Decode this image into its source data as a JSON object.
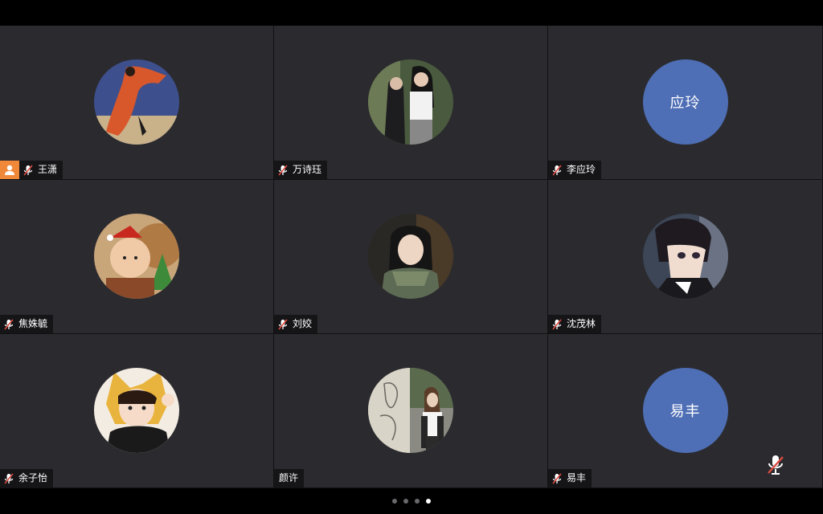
{
  "colors": {
    "tile_bg": "#2b2b2f",
    "avatar_blue": "#4e6eb5",
    "host_badge": "#f0883a",
    "mute_red": "#e04a3f"
  },
  "participants": [
    {
      "name": "王潇",
      "avatar": "photo",
      "muted": true,
      "host": true
    },
    {
      "name": "万诗珏",
      "avatar": "photo",
      "muted": true,
      "host": false
    },
    {
      "name": "李应玲",
      "avatar_text": "应玲",
      "muted": true,
      "host": false
    },
    {
      "name": "焦姝毓",
      "avatar": "photo",
      "muted": true,
      "host": false
    },
    {
      "name": "刘姣",
      "avatar": "photo",
      "muted": true,
      "host": false
    },
    {
      "name": "沈茂林",
      "avatar": "photo",
      "muted": true,
      "host": false
    },
    {
      "name": "余子怡",
      "avatar": "photo",
      "muted": true,
      "host": false
    },
    {
      "name": "颜许",
      "avatar": "photo",
      "muted": false,
      "host": false
    },
    {
      "name": "易丰",
      "avatar_text": "易丰",
      "muted": true,
      "host": false
    }
  ],
  "pager": {
    "pages": 4,
    "current": 4
  },
  "icons": {
    "mute": "mic-muted-icon",
    "host": "person-icon",
    "self_mic": "mic-muted-icon"
  }
}
